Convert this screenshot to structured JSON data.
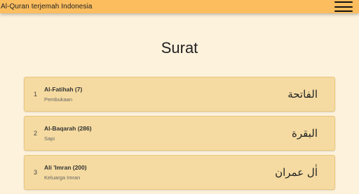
{
  "header": {
    "title": "Al-Quran terjemah Indonesia",
    "menu_icon": "hamburger-menu-icon"
  },
  "page": {
    "heading": "Surat"
  },
  "surahs": [
    {
      "number": "1",
      "name": "Al-Fatihah (7)",
      "meaning": "Pembukaan",
      "arabic": "الفاتحة"
    },
    {
      "number": "2",
      "name": "Al-Baqarah (286)",
      "meaning": "Sapi",
      "arabic": "البقرة"
    },
    {
      "number": "3",
      "name": "Ali 'Imran (200)",
      "meaning": "Keluarga Imran",
      "arabic": "اٰل عمران"
    }
  ],
  "colors": {
    "header": "#fbbd5e",
    "background": "#fdf2dc",
    "card": "#f5dba1"
  }
}
